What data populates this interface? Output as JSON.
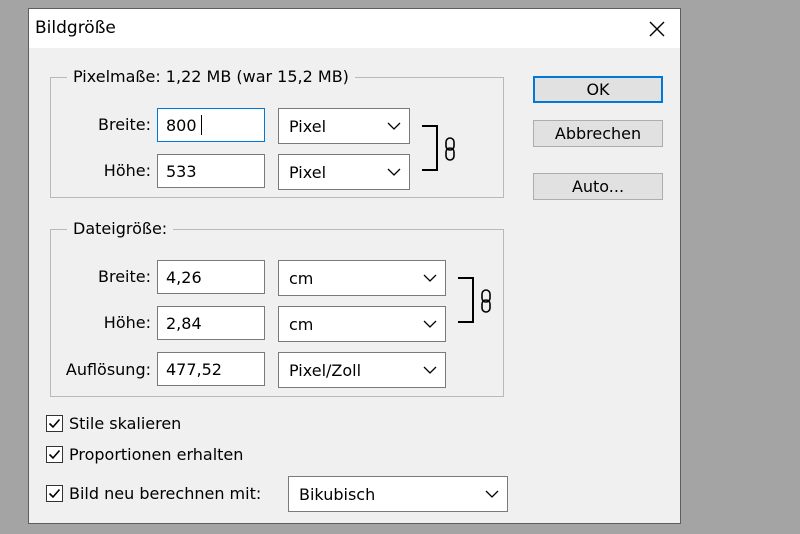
{
  "dialog": {
    "title": "Bildgröße",
    "close_icon": "close-icon"
  },
  "pixel_dimensions": {
    "legend": "Pixelmaße: 1,22 MB (war 15,2 MB)",
    "width_label": "Breite:",
    "width_value": "800",
    "width_unit": "Pixel",
    "height_label": "Höhe:",
    "height_value": "533",
    "height_unit": "Pixel",
    "link_icon": "chain-link-icon"
  },
  "document_size": {
    "legend": "Dateigröße:",
    "width_label": "Breite:",
    "width_value": "4,26",
    "width_unit": "cm",
    "height_label": "Höhe:",
    "height_value": "2,84",
    "height_unit": "cm",
    "resolution_label": "Auflösung:",
    "resolution_value": "477,52",
    "resolution_unit": "Pixel/Zoll",
    "link_icon": "chain-link-icon"
  },
  "options": {
    "scale_styles": {
      "label": "Stile skalieren",
      "checked": true
    },
    "constrain_proportions": {
      "label": "Proportionen erhalten",
      "checked": true
    },
    "resample": {
      "label": "Bild neu berechnen mit:",
      "checked": true,
      "method": "Bikubisch"
    }
  },
  "buttons": {
    "ok": "OK",
    "cancel": "Abbrechen",
    "auto": "Auto..."
  },
  "colors": {
    "dialog_bg": "#f0f0f0",
    "backdrop": "#a4a4a4",
    "focus_accent": "#0078d7"
  }
}
